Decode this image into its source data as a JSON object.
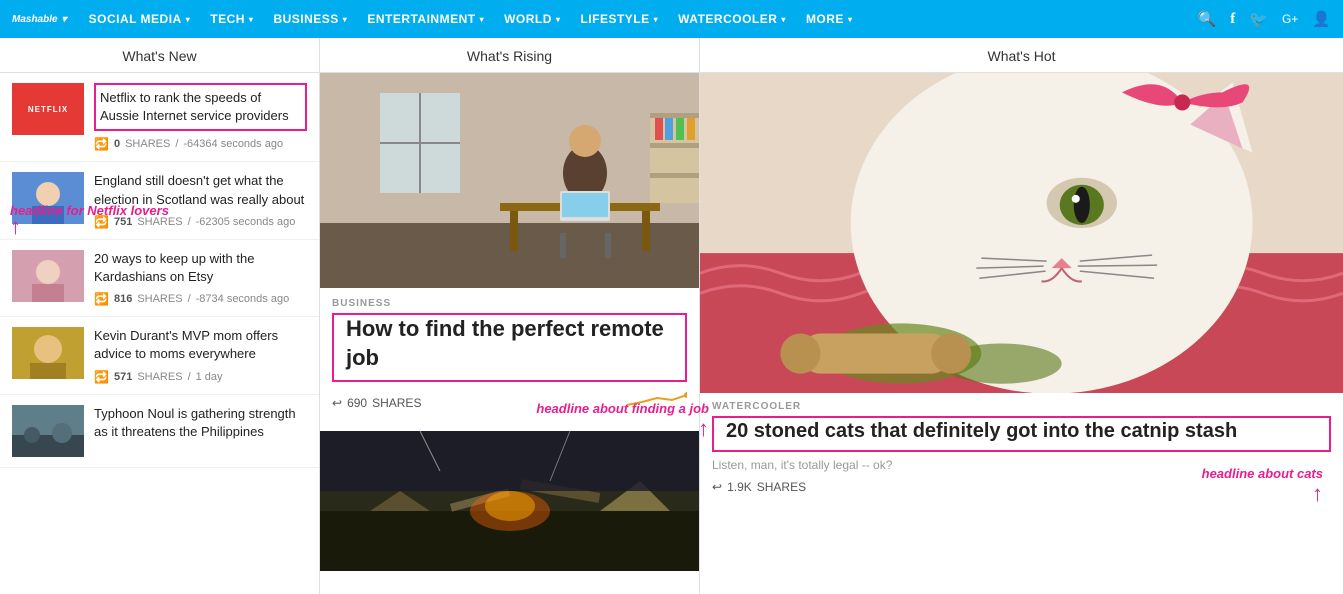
{
  "nav": {
    "logo": "Mashable",
    "logo_arrow": "▾",
    "items": [
      {
        "label": "SOCIAL MEDIA",
        "arrow": "▾"
      },
      {
        "label": "TECH",
        "arrow": "▾"
      },
      {
        "label": "BUSINESS",
        "arrow": "▾"
      },
      {
        "label": "ENTERTAINMENT",
        "arrow": "▾"
      },
      {
        "label": "WORLD",
        "arrow": "▾"
      },
      {
        "label": "LIFESTYLE",
        "arrow": "▾"
      },
      {
        "label": "WATERCOOLER",
        "arrow": "▾"
      },
      {
        "label": "MORE",
        "arrow": "▾"
      }
    ],
    "icons": [
      "🔍",
      "f",
      "𝕏",
      "G+",
      "👤"
    ]
  },
  "columns": {
    "left": {
      "header": "What's New",
      "articles": [
        {
          "title": "Netflix to rank the speeds of Aussie Internet service providers",
          "shares": "0",
          "time": "-64364 seconds ago",
          "highlighted": true,
          "thumb": "netflix"
        },
        {
          "title": "England still doesn't get what the election in Scotland was really about",
          "shares": "751",
          "time": "-62305 seconds ago",
          "highlighted": false,
          "thumb": "boy"
        },
        {
          "title": "20 ways to keep up with the Kardashians on Etsy",
          "shares": "816",
          "time": "-8734 seconds ago",
          "highlighted": false,
          "thumb": "etsy"
        },
        {
          "title": "Kevin Durant's MVP mom offers advice to moms everywhere",
          "shares": "571",
          "time": "1 day",
          "highlighted": false,
          "thumb": "kevin"
        },
        {
          "title": "Typhoon Noul is gathering strength as it threatens the Philippines",
          "shares": "",
          "time": "",
          "highlighted": false,
          "thumb": "typhoon"
        }
      ]
    },
    "mid": {
      "header": "What's Rising",
      "category": "BUSINESS",
      "title": "How to find the perfect remote job",
      "shares": "690",
      "shares_suffix": "SHARES",
      "annotation_label": "headline about finding a job"
    },
    "right": {
      "header": "What's Hot",
      "category": "WATERCOOLER",
      "title": "20 stoned cats that definitely got into the catnip stash",
      "subtitle": "Listen, man, it's totally legal -- ok?",
      "shares": "1.9K",
      "shares_suffix": "SHARES",
      "annotation_label": "headline about cats"
    }
  },
  "annotations": {
    "netflix": "headline for Netflix lovers",
    "job": "headline about finding a job",
    "cats": "headline about cats"
  }
}
